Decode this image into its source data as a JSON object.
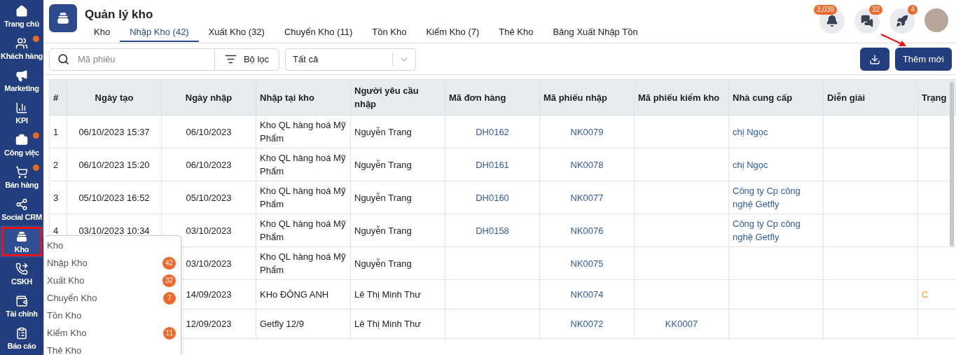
{
  "sidebar": {
    "items": [
      {
        "label": "Trang chủ",
        "selected": false,
        "notification_dot": false
      },
      {
        "label": "Khách hàng",
        "selected": false,
        "notification_dot": true
      },
      {
        "label": "Marketing",
        "selected": false,
        "notification_dot": false
      },
      {
        "label": "KPI",
        "selected": false,
        "notification_dot": false
      },
      {
        "label": "Công việc",
        "selected": false,
        "notification_dot": true
      },
      {
        "label": "Bán hàng",
        "selected": false,
        "notification_dot": true
      },
      {
        "label": "Social CRM",
        "selected": false,
        "notification_dot": false
      },
      {
        "label": "Kho",
        "selected": true,
        "notification_dot": false
      },
      {
        "label": "CSKH",
        "selected": false,
        "notification_dot": false
      },
      {
        "label": "Tài chính",
        "selected": false,
        "notification_dot": false
      },
      {
        "label": "Báo cáo",
        "selected": false,
        "notification_dot": false
      }
    ]
  },
  "header": {
    "title": "Quản lý kho",
    "tabs": [
      {
        "label": "Kho",
        "selected": false
      },
      {
        "label": "Nhập Kho (42)",
        "selected": true
      },
      {
        "label": "Xuất Kho (32)",
        "selected": false
      },
      {
        "label": "Chuyển Kho (11)",
        "selected": false
      },
      {
        "label": "Tồn Kho",
        "selected": false
      },
      {
        "label": "Kiểm Kho (7)",
        "selected": false
      },
      {
        "label": "Thẻ Kho",
        "selected": false
      },
      {
        "label": "Bảng Xuất Nhập Tồn",
        "selected": false
      }
    ],
    "notifications": [
      {
        "count": "3,039"
      },
      {
        "count": "32"
      },
      {
        "count": "4"
      }
    ]
  },
  "toolbar": {
    "search": {
      "placeholder": "Mã phiêu"
    },
    "filter_button": "Bộ lọc",
    "status_select": {
      "value": "Tất cả"
    },
    "add_button": "Thêm mới"
  },
  "table": {
    "columns": [
      {
        "label": "#",
        "kind": "index"
      },
      {
        "label": "Ngày tạo",
        "kind": "center"
      },
      {
        "label": "Ngày nhập",
        "kind": "center"
      },
      {
        "label": "Nhập tại kho",
        "kind": "text"
      },
      {
        "label": "Người yêu cầu nhập",
        "kind": "text"
      },
      {
        "label": "Mã đơn hàng",
        "kind": "code"
      },
      {
        "label": "Mã phiếu nhập",
        "kind": "code"
      },
      {
        "label": "Mã phiếu kiểm kho",
        "kind": "code"
      },
      {
        "label": "Nhà cung cấp",
        "kind": "link"
      },
      {
        "label": "Diễn giải",
        "kind": "text"
      },
      {
        "label": "Trạng",
        "kind": "status"
      }
    ],
    "rows": [
      {
        "cells": [
          "1",
          "06/10/2023 15:37",
          "06/10/2023",
          "Kho QL hàng hoá Mỹ Phẩm",
          "Nguyễn Trang",
          "DH0162",
          "NK0079",
          "",
          "chị Ngọc",
          "",
          ""
        ]
      },
      {
        "cells": [
          "2",
          "06/10/2023 15:20",
          "06/10/2023",
          "Kho QL hàng hoá Mỹ Phẩm",
          "Nguyễn Trang",
          "DH0161",
          "NK0078",
          "",
          "chị Ngọc",
          "",
          ""
        ]
      },
      {
        "cells": [
          "3",
          "05/10/2023 16:52",
          "05/10/2023",
          "Kho QL hàng hoá Mỹ Phẩm",
          "Nguyễn Trang",
          "DH0160",
          "NK0077",
          "",
          "Công ty Cp công nghệ Getfly",
          "",
          ""
        ]
      },
      {
        "cells": [
          "4",
          "03/10/2023 10:34",
          "03/10/2023",
          "Kho QL hàng hoá Mỹ Phẩm",
          "Nguyễn Trang",
          "DH0158",
          "NK0076",
          "",
          "Công ty Cp công nghệ Getfly",
          "",
          ""
        ]
      },
      {
        "cells": [
          "",
          "",
          "03/10/2023",
          "Kho QL hàng hoá Mỹ Phẩm",
          "Nguyễn Trang",
          "",
          "NK0075",
          "",
          "",
          "",
          ""
        ]
      },
      {
        "cells": [
          "",
          "",
          "14/09/2023",
          "KHo ĐÔNG ANH",
          "Lê Thị Minh Thư",
          "",
          "NK0074",
          "",
          "",
          "",
          "C"
        ]
      },
      {
        "cells": [
          "",
          "",
          "12/09/2023",
          "Getfly 12/9",
          "Lê Thị Minh Thư",
          "",
          "NK0072",
          "KK0007",
          "",
          "",
          ""
        ]
      }
    ]
  },
  "kho_menu": {
    "items": [
      {
        "label": "Kho"
      },
      {
        "label": "Nhập Kho",
        "count": "42"
      },
      {
        "label": "Xuất Kho",
        "count": "32"
      },
      {
        "label": "Chuyển Kho",
        "count": "7"
      },
      {
        "label": "Tồn Kho"
      },
      {
        "label": "Kiểm Kho",
        "count": "11"
      },
      {
        "label": "Thẻ Kho"
      }
    ]
  }
}
